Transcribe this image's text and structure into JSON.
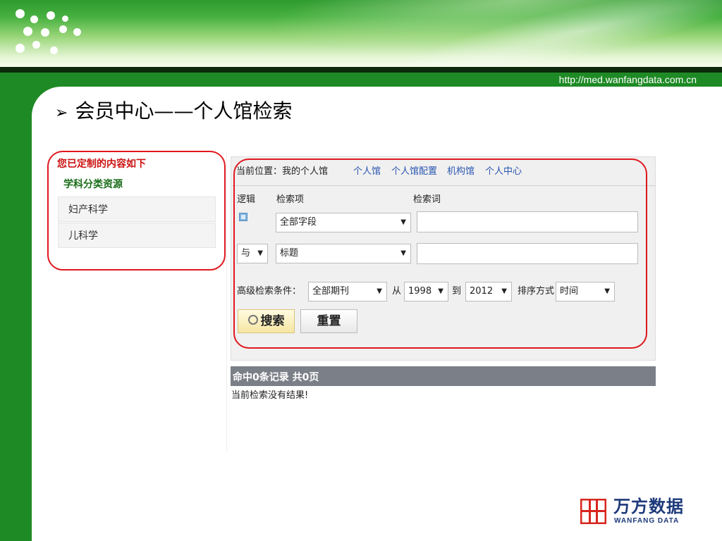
{
  "header": {
    "url": "http://med.wanfangdata.com.cn"
  },
  "slide": {
    "bullet": "➢",
    "title": "会员中心——个人馆检索"
  },
  "sidebar": {
    "heading": "您已定制的内容如下",
    "subheading": "学科分类资源",
    "items": [
      {
        "label": "妇产科学"
      },
      {
        "label": "儿科学"
      }
    ]
  },
  "breadcrumb": {
    "current": "当前位置：我的个人馆",
    "links": [
      {
        "label": "个人馆"
      },
      {
        "label": "个人馆配置"
      },
      {
        "label": "机构馆"
      },
      {
        "label": "个人中心"
      }
    ]
  },
  "search_form": {
    "col_logic": "逻辑",
    "col_field": "检索项",
    "col_term": "检索词",
    "row1_field": "全部字段",
    "row2_logic": "与",
    "row2_field": "标题",
    "advanced_label": "高级检索条件：",
    "journal_select": "全部期刊",
    "from_label": "从",
    "from_year": "1998",
    "to_label": "到",
    "to_year": "2012",
    "sort_label": "排序方式",
    "sort_select": "时间",
    "search_button": "搜索",
    "reset_button": "重置"
  },
  "results": {
    "bar": "命中0条记录 共0页",
    "message": "当前检索没有结果!"
  },
  "logo": {
    "cn": "万方数据",
    "en": "WANFANG DATA",
    "brand_color": "#1d3a7a",
    "mark_color": "#d8261e"
  }
}
